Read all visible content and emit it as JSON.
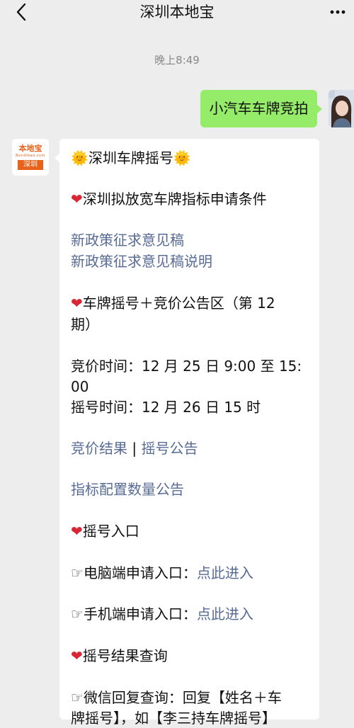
{
  "header": {
    "title": "深圳本地宝"
  },
  "chat": {
    "timestamp": "晚上8:49",
    "outgoing_message": "小汽车车牌竞拍",
    "bot_avatar": {
      "brand": "本地宝",
      "domain": "Bendibao.com",
      "city": "深圳"
    },
    "incoming": {
      "title": "深圳车牌摇号",
      "sun_emoji": "🌞",
      "heart_emoji": "❤",
      "hand_emoji": "☞",
      "section1": "深圳拟放宽车牌指标申请条件",
      "link1": "新政策征求意见稿",
      "link2": "新政策征求意见稿说明",
      "section2_line1": "车牌摇号＋竞价公告区（第 12",
      "section2_line2": "期）",
      "bid_time_line1": "竞价时间：12 月 25 日 9:00 至 15:",
      "bid_time_line2": "00",
      "lottery_time": "摇号时间：12 月 26 日 15 时",
      "link_bid_result": "竞价结果",
      "link_separator": " | ",
      "link_lottery_notice": "摇号公告",
      "link_quota": "指标配置数量公告",
      "section3": "摇号入口",
      "pc_label": "电脑端申请入口：",
      "pc_link": "点此进入",
      "mobile_label": "手机端申请入口：",
      "mobile_link": "点此进入",
      "section4": "摇号结果查询",
      "wechat_line1": "微信回复查询：回复【姓名＋车",
      "wechat_line2": "牌摇号】，如【李三持车牌摇号】"
    }
  },
  "colors": {
    "background": "#ededed",
    "outgoing_bubble": "#95ec69",
    "link": "#576b95",
    "brand_orange": "#e8621a"
  }
}
